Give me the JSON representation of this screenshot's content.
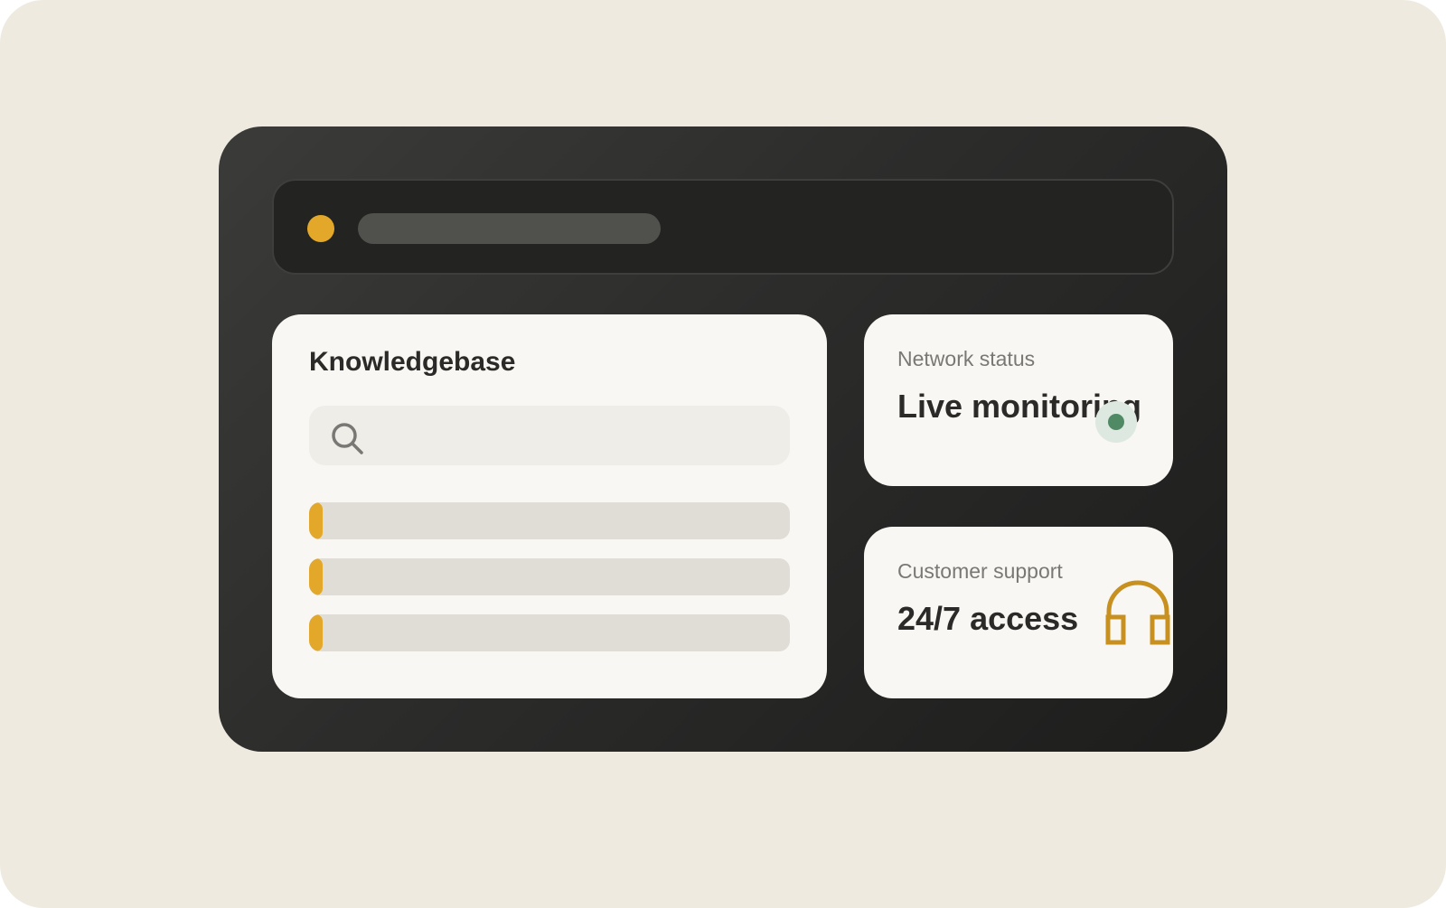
{
  "colors": {
    "accent": "#e3a829",
    "headset": "#c8901f",
    "status_dot": "#4f8a64"
  },
  "topbar": {
    "indicator_icon": "status-dot-icon"
  },
  "knowledgebase": {
    "title": "Knowledgebase",
    "search": {
      "icon": "search-icon",
      "value": "",
      "placeholder": ""
    },
    "items": [
      {
        "label": ""
      },
      {
        "label": ""
      },
      {
        "label": ""
      }
    ]
  },
  "network_status": {
    "label": "Network status",
    "value": "Live monitoring",
    "indicator_icon": "online-indicator-icon"
  },
  "customer_support": {
    "label": "Customer support",
    "value": "24/7 access",
    "icon": "headset-icon"
  }
}
